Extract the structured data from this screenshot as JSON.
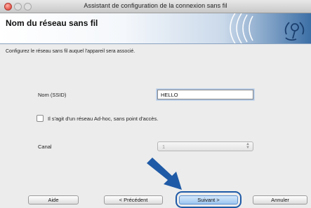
{
  "window": {
    "title": "Assistant de configuration de la connexion sans fil"
  },
  "header": {
    "title": "Nom du réseau sans fil"
  },
  "content": {
    "intro": "Configurez le réseau sans fil auquel l'appareil sera associé.",
    "ssid_label": "Nom (SSID)",
    "ssid_value": "HELLO",
    "adhoc_label": "Il s'agit d'un réseau Ad-hoc, sans point d'accès.",
    "adhoc_checked": false,
    "channel_label": "Canal",
    "channel_value": "1"
  },
  "buttons": {
    "help": "Aide",
    "previous": "< Précédent",
    "next": "Suivant >",
    "cancel": "Annuler"
  },
  "colors": {
    "accent": "#1f5aa6",
    "banner_dark": "#3c6fa6"
  },
  "icons": {
    "logo": "wireless-logo-icon",
    "pointer": "arrow-pointer-icon"
  }
}
